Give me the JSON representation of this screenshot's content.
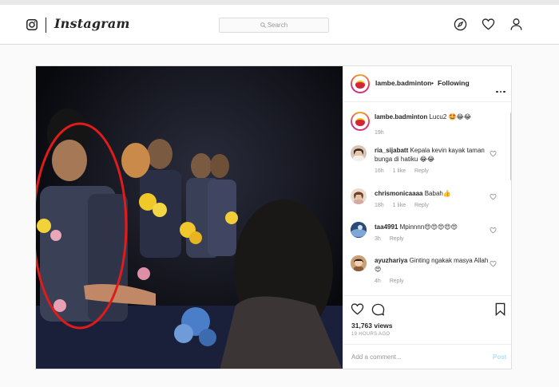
{
  "header": {
    "brand": "Instagram",
    "search_placeholder": "Search"
  },
  "post": {
    "username": "lambe.badminton",
    "separator": "•",
    "follow_status": "Following",
    "caption": "Lucu2 🤩😂😂",
    "caption_age": "19h",
    "comments": [
      {
        "user": "ria_sijabatt",
        "text": "Kepala kevin kayak taman bunga di hatiku 😂😂",
        "age": "16h",
        "likes": "1 like",
        "reply": "Reply"
      },
      {
        "user": "chrismonicaaaa",
        "text": "Babah👍",
        "age": "18h",
        "likes": "1 like",
        "reply": "Reply"
      },
      {
        "user": "taa4991",
        "text": "Mpinnnn😍😍😍😍😍",
        "age": "3h",
        "likes": "",
        "reply": "Reply"
      },
      {
        "user": "ayuzhariya",
        "text": "Ginting ngakak masya Allah😍",
        "age": "4h",
        "likes": "",
        "reply": "Reply"
      }
    ],
    "views": "31,763 views",
    "time_ago": "19 HOURS AGO",
    "add_comment_placeholder": "Add a comment...",
    "post_button": "Post"
  },
  "colors": {
    "accent_link": "#b2dffc",
    "annotation_circle": "#e01b1b"
  },
  "icons": {
    "logo": "instagram-camera-icon",
    "explore": "compass-icon",
    "activity": "heart-icon",
    "profile": "user-icon",
    "like": "heart-outline-icon",
    "comment": "comment-bubble-icon",
    "save": "bookmark-icon",
    "more": "more-dots-icon"
  }
}
